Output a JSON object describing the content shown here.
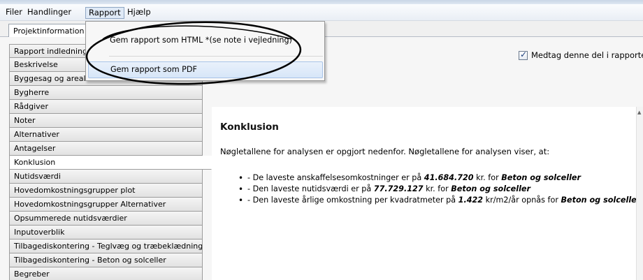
{
  "menubar": {
    "items": [
      "Filer",
      "Handlinger",
      "Rapport",
      "Hjælp"
    ]
  },
  "tab": {
    "label": "Projektinformation"
  },
  "dropdown": {
    "items": [
      "Gem rapport som HTML *(se note i vejledning)",
      "Gem rapport som PDF"
    ]
  },
  "option": {
    "include_label": "Medtag denne del i rapporten",
    "checked": true
  },
  "sidebar": {
    "items": [
      "Rapport indledning",
      "Beskrivelse",
      "Byggesag og areal",
      "Bygherre",
      "Rådgiver",
      "Noter",
      "Alternativer",
      "Antagelser",
      "Konklusion",
      "Nutidsværdi",
      "Hovedomkostningsgrupper plot",
      "Hovedomkostningsgrupper Alternativer",
      "Opsummerede nutidsværdier",
      "Inputoverblik",
      "Tilbagediskontering - Teglvæg og træbeklædning",
      "Tilbagediskontering - Beton og solceller",
      "Begreber"
    ],
    "selected": "Konklusion"
  },
  "document": {
    "title": "Konklusion",
    "intro": "Nøgletallene for analysen er opgjort nedenfor. Nøgletallene for analysen viser, at:",
    "bullets": [
      {
        "pre": "- De laveste anskaffelsesomkostninger er på ",
        "value": "41.684.720",
        "mid": " kr. for ",
        "alt": "Beton og solceller"
      },
      {
        "pre": "- Den laveste nutidsværdi er på ",
        "value": "77.729.127",
        "mid": " kr. for ",
        "alt": "Beton og solceller"
      },
      {
        "pre": "- Den laveste årlige omkostning per kvadratmeter på ",
        "value": "1.422",
        "mid": " kr/m2/år opnås for ",
        "alt": "Beton og solceller"
      }
    ]
  },
  "icons": {
    "checkbox": "checkmark-icon",
    "scroll": "scroll-up-arrow-icon"
  }
}
